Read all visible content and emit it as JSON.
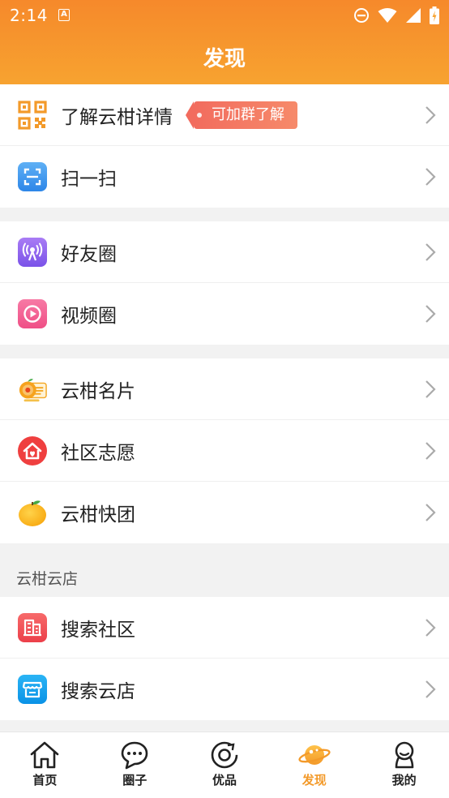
{
  "status_bar": {
    "time": "2:14",
    "notif_icon": "A"
  },
  "header": {
    "title": "发现"
  },
  "groups": [
    {
      "items": [
        {
          "label": "了解云柑详情",
          "icon": "qrcode-icon",
          "tag": "可加群了解"
        },
        {
          "label": "扫一扫",
          "icon": "scan-icon"
        }
      ]
    },
    {
      "items": [
        {
          "label": "好友圈",
          "icon": "broadcast-icon"
        },
        {
          "label": "视频圈",
          "icon": "video-icon"
        }
      ]
    },
    {
      "items": [
        {
          "label": "云柑名片",
          "icon": "business-card-icon"
        },
        {
          "label": "社区志愿",
          "icon": "volunteer-house-icon"
        },
        {
          "label": "云柑快团",
          "icon": "orange-icon"
        }
      ]
    }
  ],
  "store_section": {
    "title": "云柑云店",
    "items": [
      {
        "label": "搜索社区",
        "icon": "building-icon"
      },
      {
        "label": "搜索云店",
        "icon": "store-icon"
      }
    ]
  },
  "tabbar": {
    "active_color": "#f39a2a",
    "items": [
      {
        "label": "首页",
        "icon": "home-icon"
      },
      {
        "label": "圈子",
        "icon": "chat-icon"
      },
      {
        "label": "优品",
        "icon": "refresh-ring-icon"
      },
      {
        "label": "发现",
        "icon": "planet-icon",
        "active": true
      },
      {
        "label": "我的",
        "icon": "user-icon"
      }
    ]
  },
  "colors": {
    "header_top": "#f6892b",
    "header_bottom": "#f7a330",
    "tag": "#f26c5e"
  }
}
